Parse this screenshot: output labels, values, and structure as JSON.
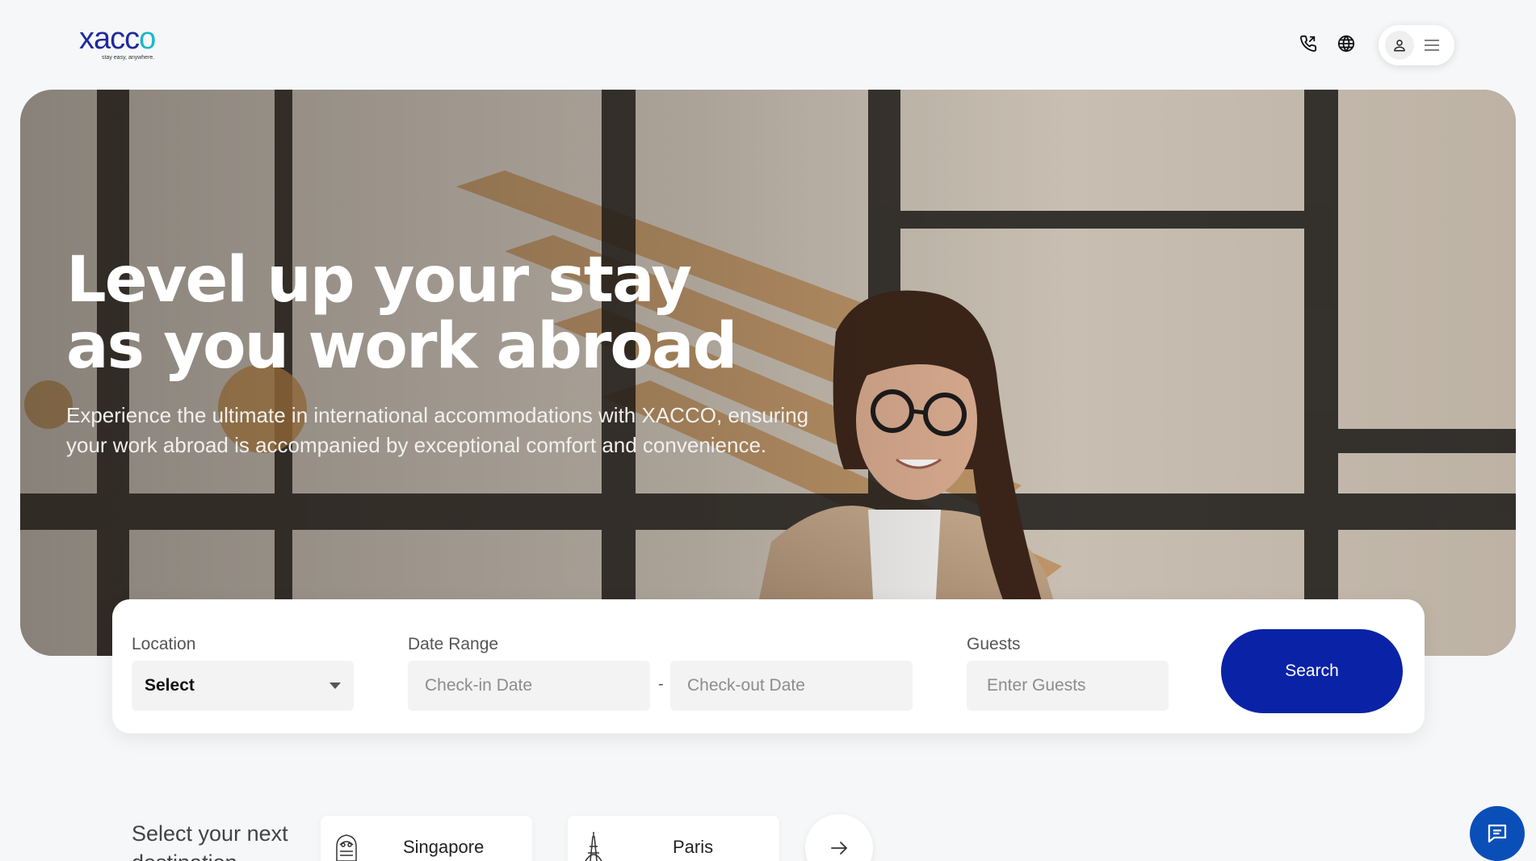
{
  "brand": {
    "logo_text": "xacco",
    "tagline": "stay easy, anywhere."
  },
  "header": {
    "icons": [
      "phone-icon",
      "globe-icon",
      "user-icon",
      "menu-icon"
    ]
  },
  "hero": {
    "title_line1": "Level up your stay",
    "title_line2": "as you work abroad",
    "subtitle": "Experience the ultimate in international accommodations with XACCO, ensuring your work abroad is accompanied by exceptional comfort and convenience."
  },
  "search": {
    "location_label": "Location",
    "location_value": "Select",
    "date_label": "Date Range",
    "checkin_placeholder": "Check-in Date",
    "date_separator": "-",
    "checkout_placeholder": "Check-out Date",
    "guests_label": "Guests",
    "guests_placeholder": "Enter Guests",
    "search_button": "Search"
  },
  "destinations": {
    "title": "Select your next destination",
    "items": [
      {
        "label": "Singapore",
        "icon": "merlion-icon"
      },
      {
        "label": "Paris",
        "icon": "eiffel-tower-icon"
      }
    ]
  },
  "colors": {
    "brand_blue": "#1f2a9c",
    "brand_teal": "#19b8c9",
    "button_blue": "#0a23a6",
    "chat_blue": "#0a4fb8"
  }
}
